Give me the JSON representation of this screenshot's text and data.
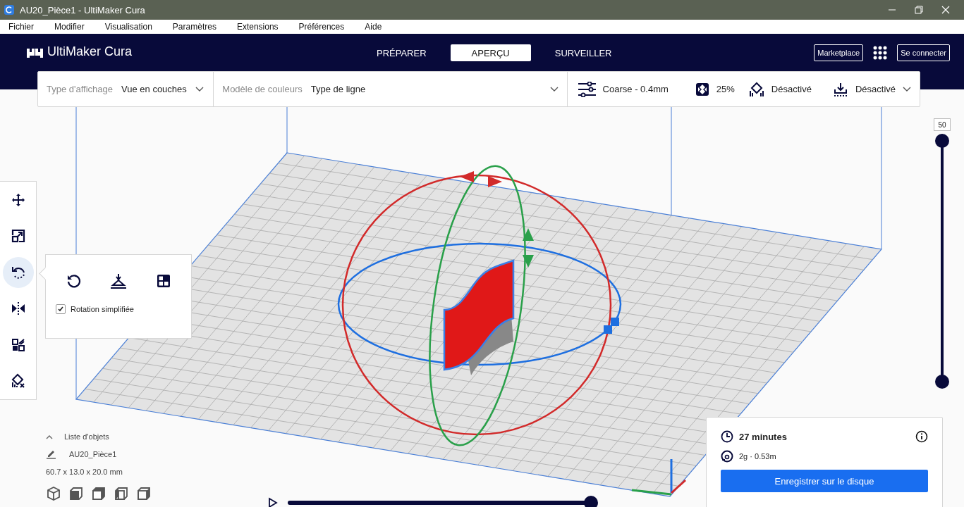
{
  "window": {
    "title": "AU20_Pièce1 - UltiMaker Cura"
  },
  "menu": [
    "Fichier",
    "Modifier",
    "Visualisation",
    "Paramètres",
    "Extensions",
    "Préférences",
    "Aide"
  ],
  "header": {
    "logo": "UltiMaker Cura",
    "marketplace": "Marketplace",
    "sign_in": "Se connecter",
    "stages": [
      {
        "label": "PRÉPARER",
        "selected": false
      },
      {
        "label": "APERÇU",
        "selected": true
      },
      {
        "label": "SURVEILLER",
        "selected": false
      }
    ]
  },
  "view_bar": {
    "view_type_label": "Type d'affichage",
    "view_type": "Vue en couches",
    "color_scheme_label": "Modèle de couleurs",
    "color_scheme": "Type de ligne",
    "profile": "Coarse - 0.4mm",
    "infill": "25%",
    "support": "Désactivé",
    "adhesion": "Désactivé"
  },
  "tools": [
    {
      "kind": "move",
      "selected": false
    },
    {
      "kind": "scale",
      "selected": false
    },
    {
      "kind": "rotate",
      "selected": true
    },
    {
      "kind": "mirror",
      "selected": false
    },
    {
      "kind": "per_model",
      "selected": false
    },
    {
      "kind": "support_blocker",
      "selected": false
    }
  ],
  "rotate_panel": {
    "actions": [
      {
        "kind": "reset"
      },
      {
        "kind": "lay_flat"
      },
      {
        "kind": "select_face"
      }
    ],
    "snap_rotation": {
      "label": "Rotation simplifiée",
      "checked": true
    }
  },
  "layer_slider": {
    "value": "50",
    "level": 1
  },
  "object_list": {
    "title": "Liste d'objets",
    "expanded": true,
    "object": "AU20_Pièce1",
    "dimensions": "60.7 x 13.0 x 20.0 mm"
  },
  "camera_views": [
    {
      "kind": "iso"
    },
    {
      "kind": "front"
    },
    {
      "kind": "top"
    },
    {
      "kind": "left"
    },
    {
      "kind": "right"
    }
  ],
  "playback": {
    "level": 1
  },
  "print_info": {
    "time": "27 minutes",
    "material": "2g · 0.53m",
    "save_button": "Enregistrer sur le disque"
  }
}
